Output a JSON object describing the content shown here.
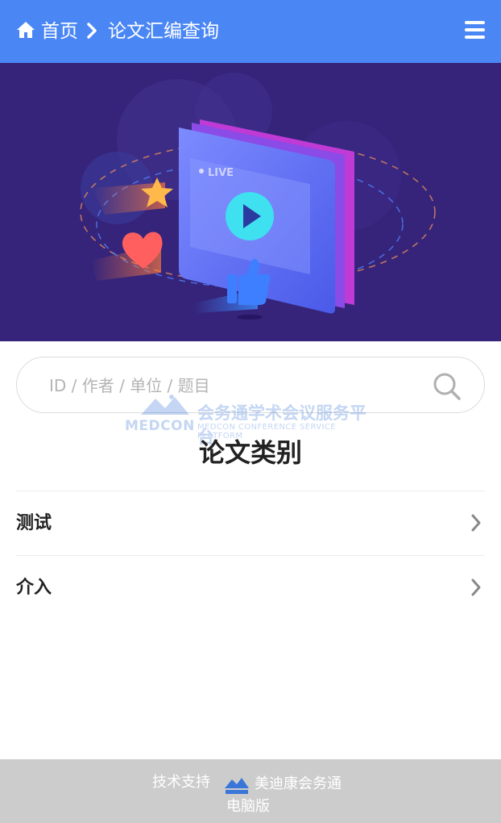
{
  "header": {
    "home_icon": "home-icon",
    "breadcrumb_home": "首页",
    "separator_icon": "chevron-right-icon",
    "breadcrumb_current": "论文汇编查询",
    "menu_icon": "hamburger-menu-icon",
    "background_color": "#4a87f5"
  },
  "banner": {
    "live_badge": "LIVE",
    "background_color": "#35247a"
  },
  "search": {
    "placeholder": "ID / 作者 / 单位 / 题目",
    "value": "",
    "icon": "search-icon"
  },
  "watermark": {
    "logo_text": "MEDCON",
    "title": "会务通学术会议服务平台",
    "subtitle": "MEDCON CONFERENCE SERVICE PLATFORM"
  },
  "section_title": "论文类别",
  "categories": [
    {
      "label": "测试"
    },
    {
      "label": "介入"
    }
  ],
  "footer": {
    "support_label": "技术支持",
    "brand_name": "美迪康会务通",
    "desktop_link": "电脑版",
    "background_color": "#cccccc"
  }
}
